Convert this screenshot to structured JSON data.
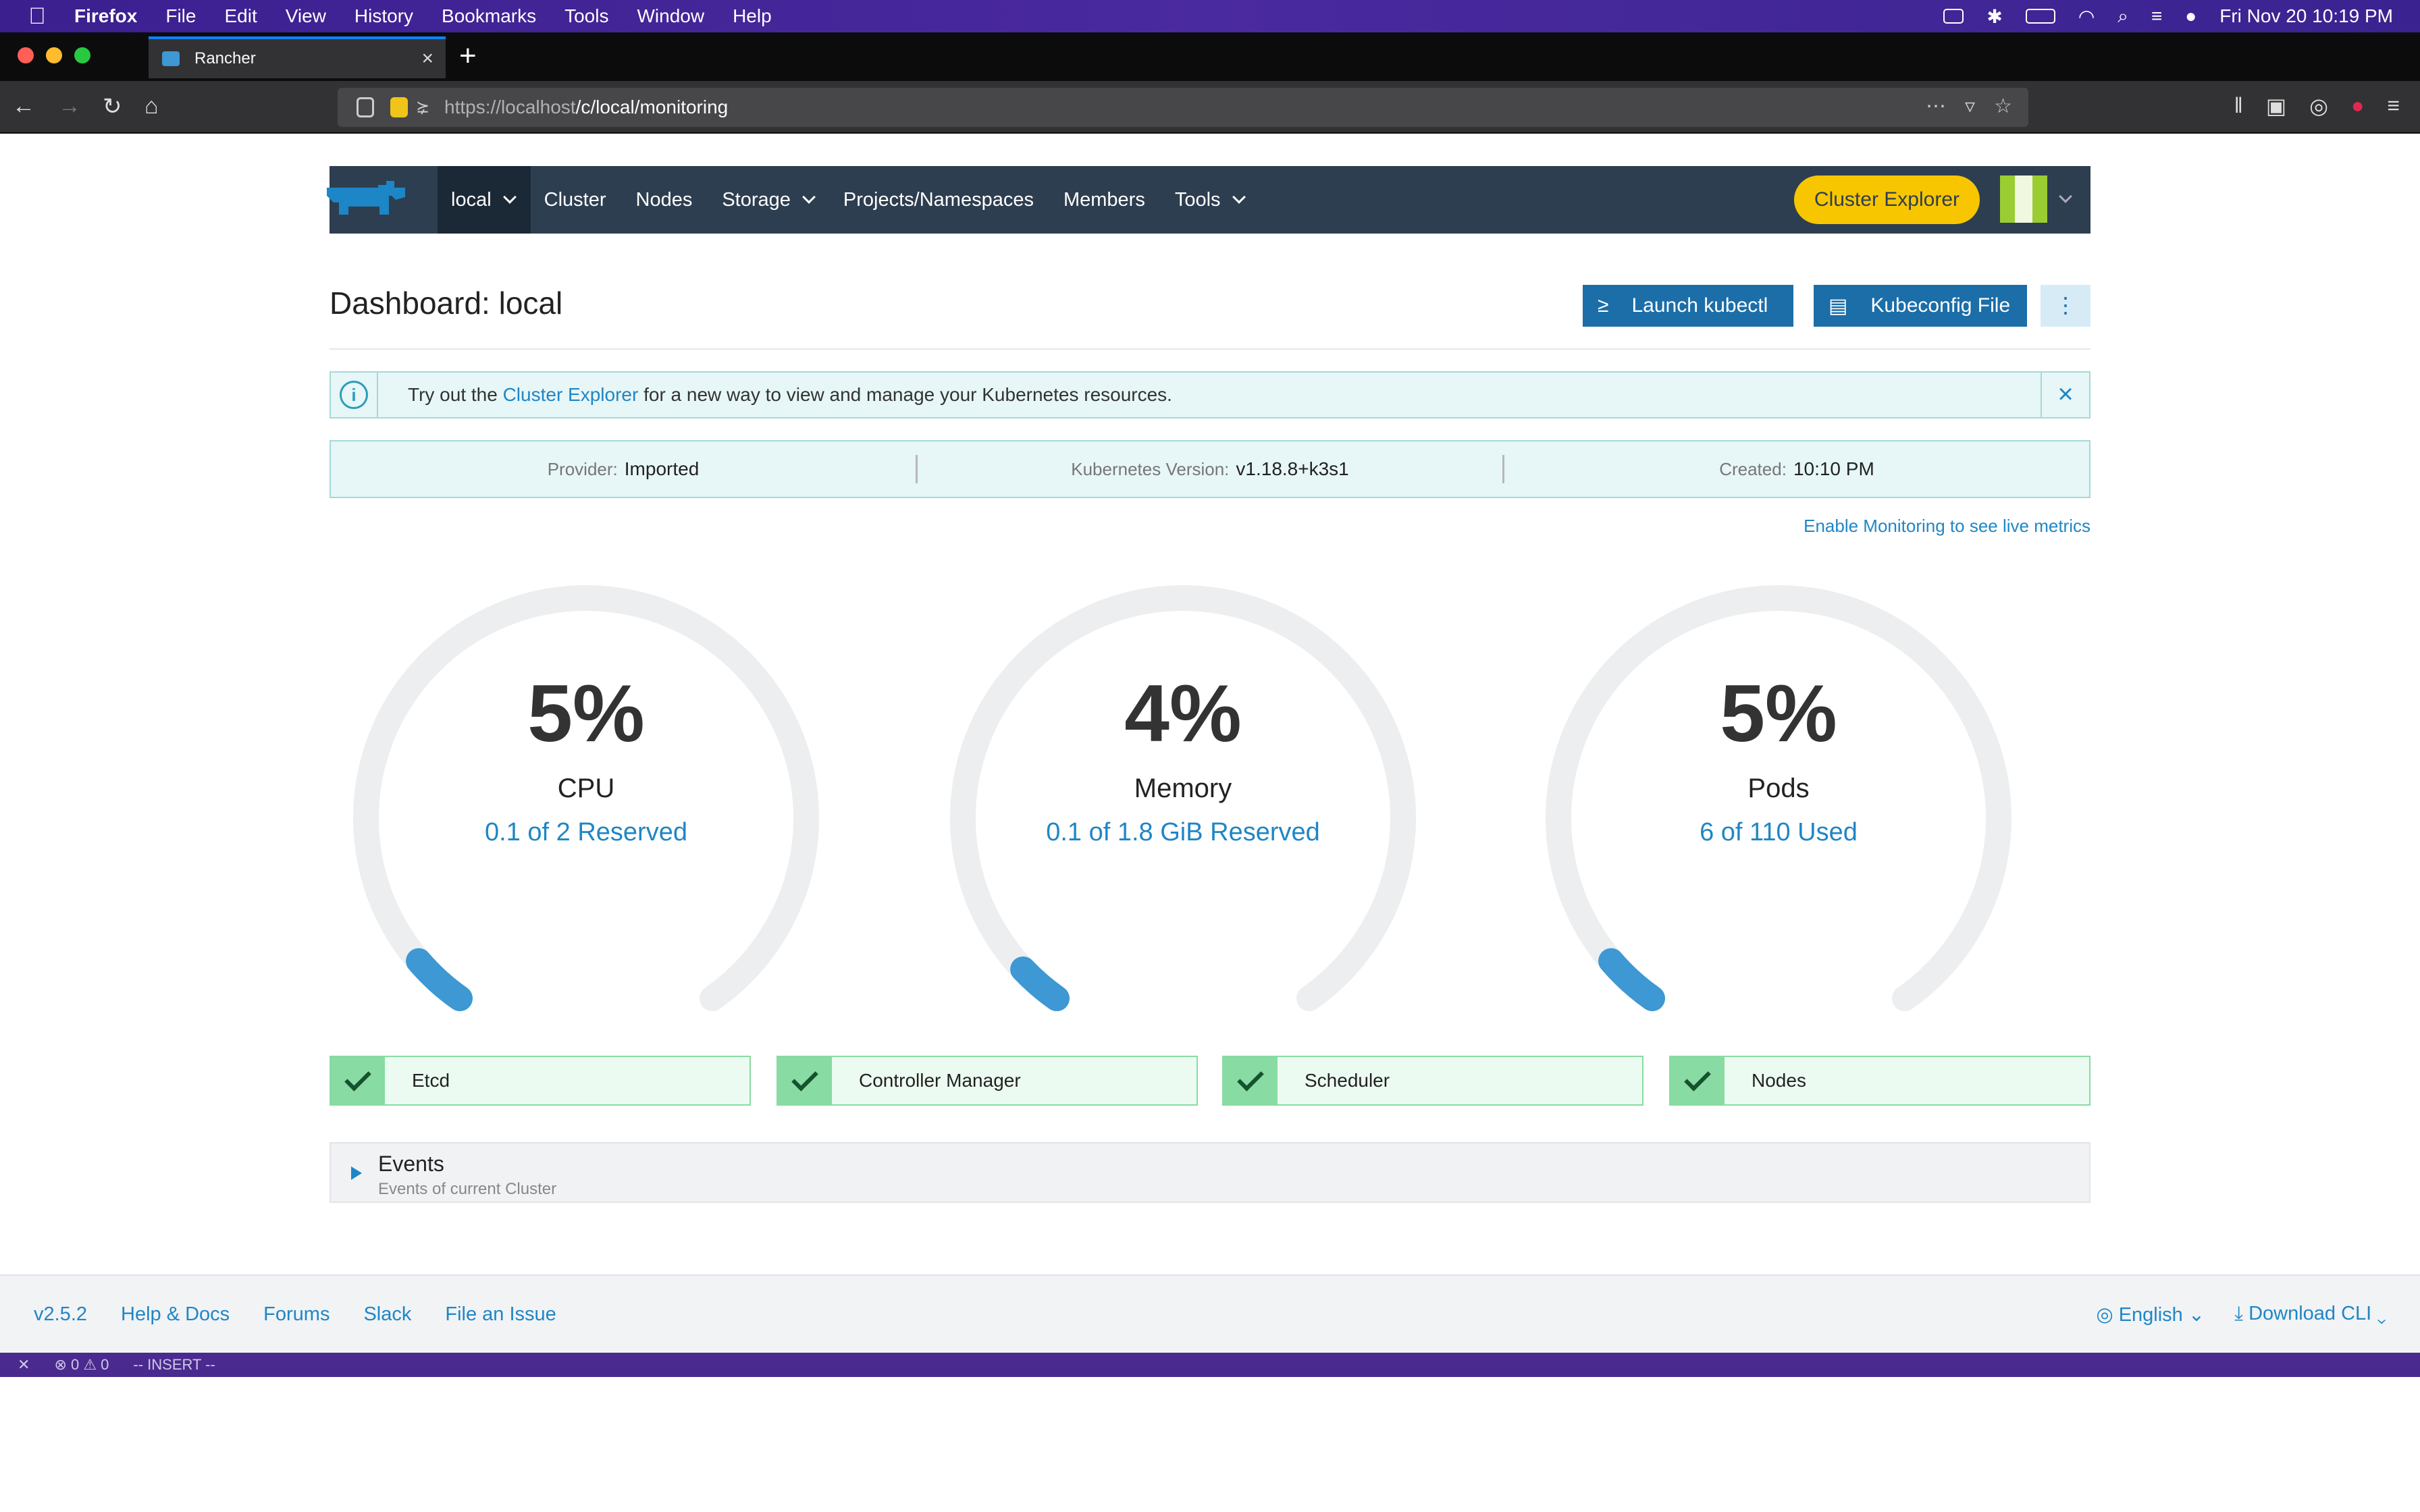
{
  "menubar": {
    "app": "Firefox",
    "items": [
      "File",
      "Edit",
      "View",
      "History",
      "Bookmarks",
      "Tools",
      "Window",
      "Help"
    ],
    "clock": "Fri Nov 20  10:19 PM"
  },
  "browser": {
    "tab_title": "Rancher",
    "url_scheme": "https://",
    "url_host": "localhost",
    "url_path": "/c/local/monitoring"
  },
  "header": {
    "cluster": "local",
    "nav": [
      "Cluster",
      "Nodes",
      "Storage",
      "Projects/Namespaces",
      "Members",
      "Tools"
    ],
    "explorer_button": "Cluster Explorer"
  },
  "page": {
    "title": "Dashboard: local",
    "launch_kubectl": "Launch kubectl",
    "kubeconfig": "Kubeconfig File",
    "more_glyph": "⋮"
  },
  "banner": {
    "prefix": "Try out the ",
    "link": "Cluster Explorer",
    "suffix": " for a new way to view and manage your Kubernetes resources."
  },
  "info": {
    "provider_label": "Provider:",
    "provider": "Imported",
    "k8s_label": "Kubernetes Version:",
    "k8s": "v1.18.8+k3s1",
    "created_label": "Created:",
    "created": "10:10 PM"
  },
  "monitoring_link": "Enable Monitoring to see live metrics",
  "gauges": [
    {
      "value": "5%",
      "name": "CPU",
      "sub": "0.1 of 2 Reserved",
      "fraction": 0.05
    },
    {
      "value": "4%",
      "name": "Memory",
      "sub": "0.1 of 1.8 GiB Reserved",
      "fraction": 0.04
    },
    {
      "value": "5%",
      "name": "Pods",
      "sub": "6 of 110 Used",
      "fraction": 0.05
    }
  ],
  "components": [
    "Etcd",
    "Controller Manager",
    "Scheduler",
    "Nodes"
  ],
  "events": {
    "title": "Events",
    "subtitle": "Events of current Cluster"
  },
  "footer": {
    "version": "v2.5.2",
    "links": [
      "Help & Docs",
      "Forums",
      "Slack",
      "File an Issue"
    ],
    "language": "English",
    "download": "Download CLI"
  },
  "vim": {
    "counts": "⊗ 0 ⚠ 0",
    "mode": "-- INSERT --"
  },
  "colors": {
    "accent": "#1f86c6",
    "nav_bg": "#2d3e50",
    "explorer_btn": "#f7c600",
    "gauge_track": "#eceeef",
    "gauge_fill": "#3d98d3"
  }
}
